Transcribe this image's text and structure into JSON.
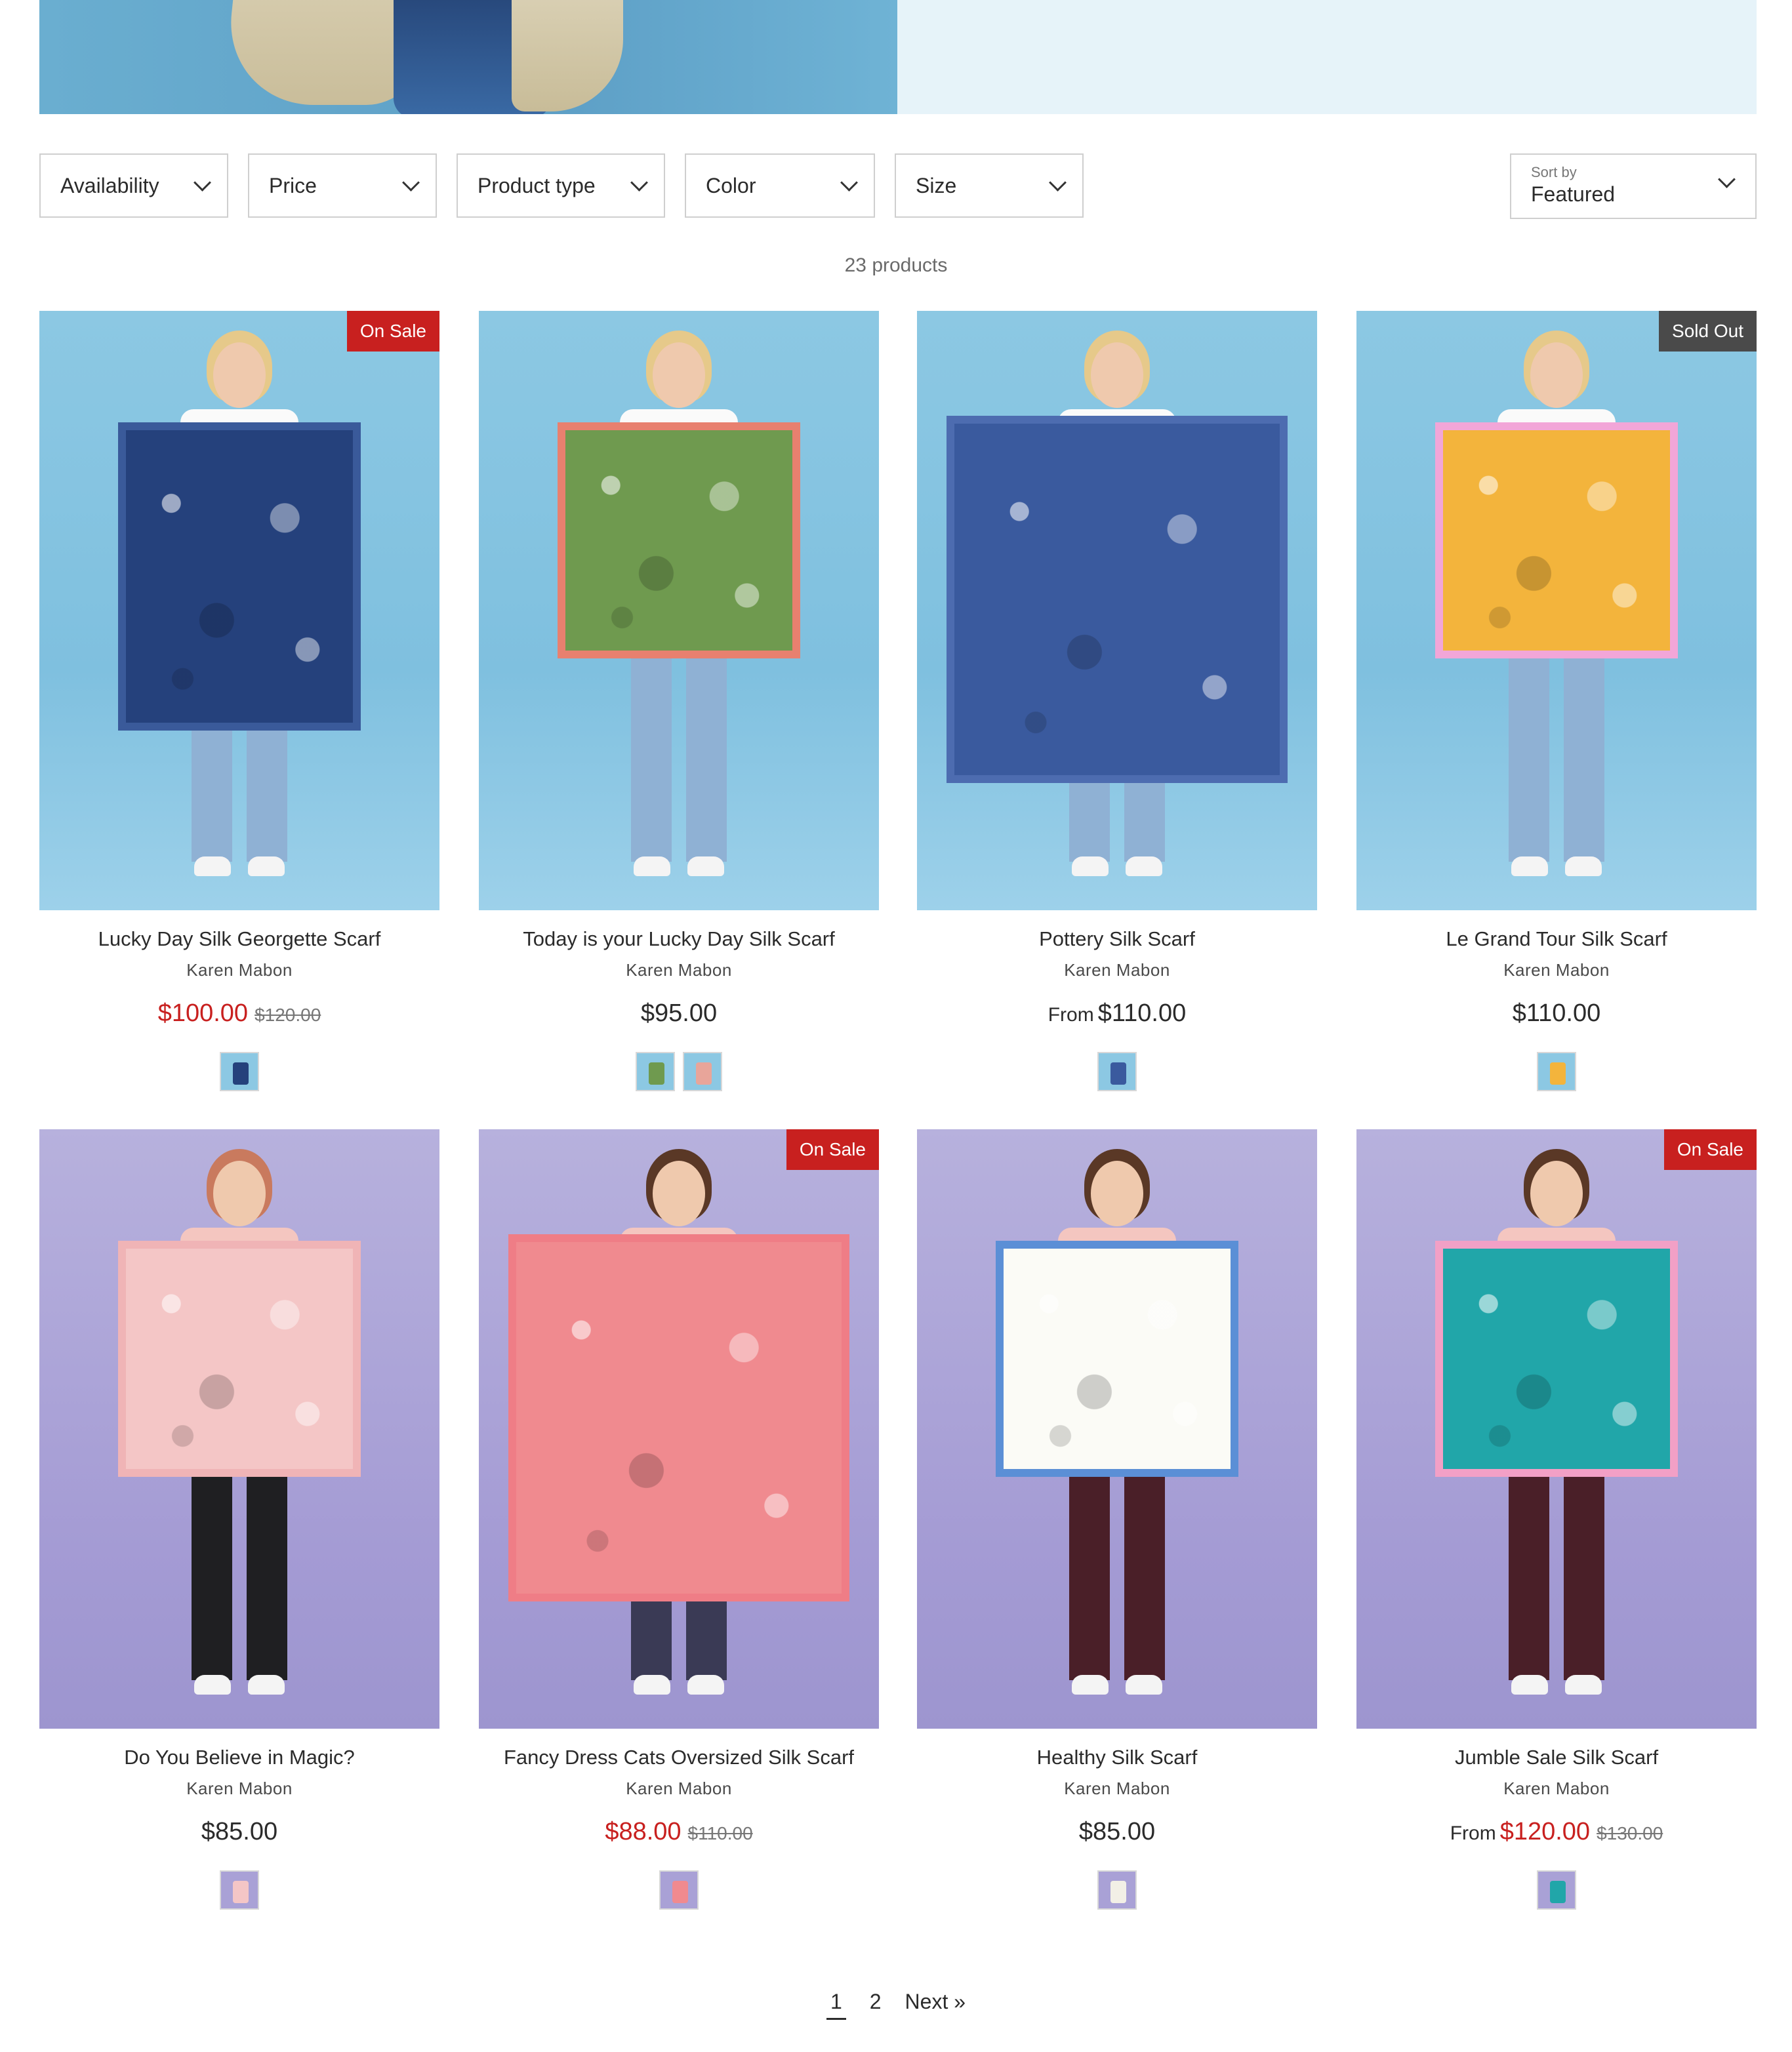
{
  "filters": {
    "availability": "Availability",
    "price": "Price",
    "product_type": "Product type",
    "color": "Color",
    "size": "Size"
  },
  "sort": {
    "label": "Sort by",
    "value": "Featured"
  },
  "product_count": "23 products",
  "products": [
    {
      "name": "Lucky Day Silk Georgette Scarf",
      "vendor": "Karen Mabon",
      "from": "",
      "price": "$100.00",
      "compare": "$120.00",
      "badge": "On Sale",
      "on_sale": true,
      "bg": "blue",
      "scarf_color": "#25417c",
      "scarf_border": "#3a5a9a",
      "swatch_colors": [
        "#25417c"
      ]
    },
    {
      "name": "Today is your Lucky Day Silk Scarf",
      "vendor": "Karen Mabon",
      "from": "",
      "price": "$95.00",
      "compare": "",
      "badge": "",
      "on_sale": false,
      "bg": "blue",
      "scarf_color": "#6f9a4f",
      "scarf_border": "#e8806f",
      "swatch_colors": [
        "#6f9a4f",
        "#e8a59a"
      ]
    },
    {
      "name": "Pottery Silk Scarf",
      "vendor": "Karen Mabon",
      "from": "From",
      "price": "$110.00",
      "compare": "",
      "badge": "",
      "on_sale": false,
      "bg": "blue",
      "scarf_color": "#3a5a9e",
      "scarf_border": "#4d6cb0",
      "swatch_colors": [
        "#3a5a9e"
      ]
    },
    {
      "name": "Le Grand Tour Silk Scarf",
      "vendor": "Karen Mabon",
      "from": "",
      "price": "$110.00",
      "compare": "",
      "badge": "Sold Out",
      "on_sale": false,
      "bg": "blue",
      "scarf_color": "#f3b43c",
      "scarf_border": "#f2a6d8",
      "swatch_colors": [
        "#f3b43c"
      ]
    },
    {
      "name": "Do You Believe in Magic?",
      "vendor": "Karen Mabon",
      "from": "",
      "price": "$85.00",
      "compare": "",
      "badge": "",
      "on_sale": false,
      "bg": "purple",
      "scarf_color": "#f4c6c6",
      "scarf_border": "#f0b4b6",
      "swatch_colors": [
        "#f4c6c6"
      ]
    },
    {
      "name": "Fancy Dress Cats Oversized Silk Scarf",
      "vendor": "Karen Mabon",
      "from": "",
      "price": "$88.00",
      "compare": "$110.00",
      "badge": "On Sale",
      "on_sale": true,
      "bg": "purple",
      "scarf_color": "#f08a8f",
      "scarf_border": "#ef7d86",
      "swatch_colors": [
        "#f08a8f"
      ]
    },
    {
      "name": "Healthy Silk Scarf",
      "vendor": "Karen Mabon",
      "from": "",
      "price": "$85.00",
      "compare": "",
      "badge": "",
      "on_sale": false,
      "bg": "purple",
      "scarf_color": "#fbfbf6",
      "scarf_border": "#5b8fd6",
      "swatch_colors": [
        "#f2efe6"
      ]
    },
    {
      "name": "Jumble Sale Silk Scarf",
      "vendor": "Karen Mabon",
      "from": "From",
      "price": "$120.00",
      "compare": "$130.00",
      "badge": "On Sale",
      "on_sale": true,
      "bg": "purple",
      "scarf_color": "#21a6a9",
      "scarf_border": "#f2a0c6",
      "swatch_colors": [
        "#21a6a9"
      ]
    }
  ],
  "pagination": {
    "current": "1",
    "page2": "2",
    "next": "Next »"
  }
}
